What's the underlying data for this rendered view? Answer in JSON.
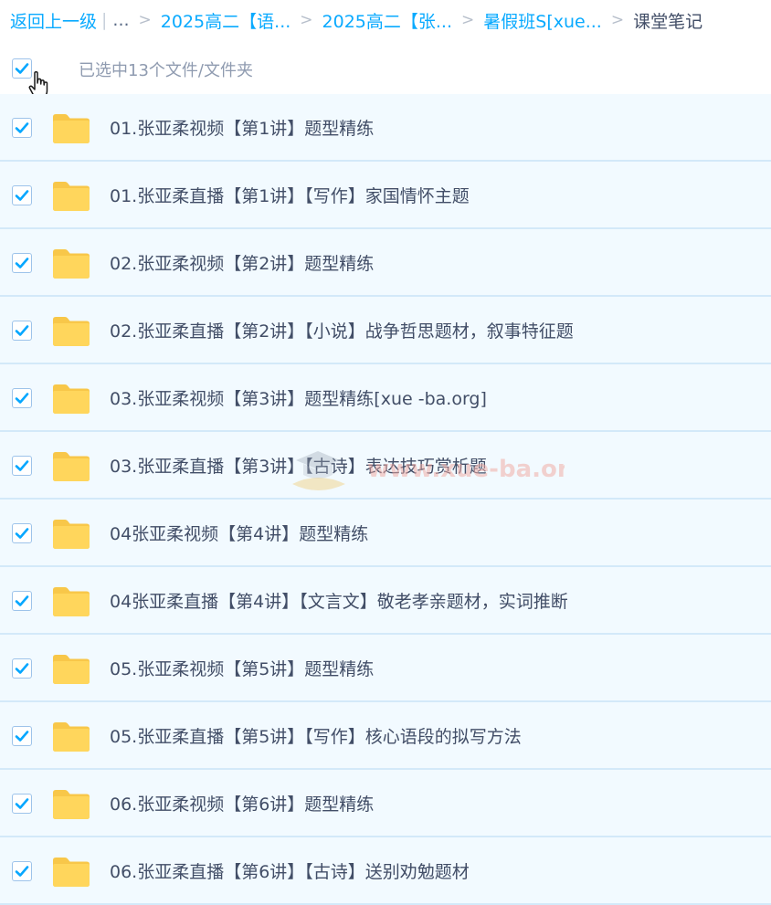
{
  "breadcrumb": {
    "back_label": "返回上一级",
    "separator_pipe": "|",
    "ellipsis": "...",
    "arrow": ">",
    "items": [
      "2025高二【语...",
      "2025高二【张...",
      "暑假班S[xue..."
    ],
    "current": "课堂笔记"
  },
  "selection": {
    "count_label": "已选中13个文件/文件夹"
  },
  "files": [
    {
      "name": "01.张亚柔视频【第1讲】题型精练"
    },
    {
      "name": "01.张亚柔直播【第1讲】【写作】家国情怀主题"
    },
    {
      "name": "02.张亚柔视频【第2讲】题型精练"
    },
    {
      "name": "02.张亚柔直播【第2讲】【小说】战争哲思题材，叙事特征题"
    },
    {
      "name": "03.张亚柔视频【第3讲】题型精练[xue -ba.org]"
    },
    {
      "name": "03.张亚柔直播【第3讲】【古诗】表达技巧赏析题"
    },
    {
      "name": "04张亚柔视频【第4讲】题型精练"
    },
    {
      "name": "04张亚柔直播【第4讲】【文言文】敬老孝亲题材，实词推断"
    },
    {
      "name": "05.张亚柔视频【第5讲】题型精练"
    },
    {
      "name": "05.张亚柔直播【第5讲】【写作】核心语段的拟写方法"
    },
    {
      "name": "06.张亚柔视频【第6讲】题型精练"
    },
    {
      "name": "06.张亚柔直播【第6讲】【古诗】送别劝勉题材"
    }
  ],
  "watermark": {
    "text": "www.xue-ba.org"
  },
  "colors": {
    "link": "#09aaff",
    "check": "#06a7ff",
    "row_bg": "#f2faff",
    "folder": "#ffd65c"
  }
}
